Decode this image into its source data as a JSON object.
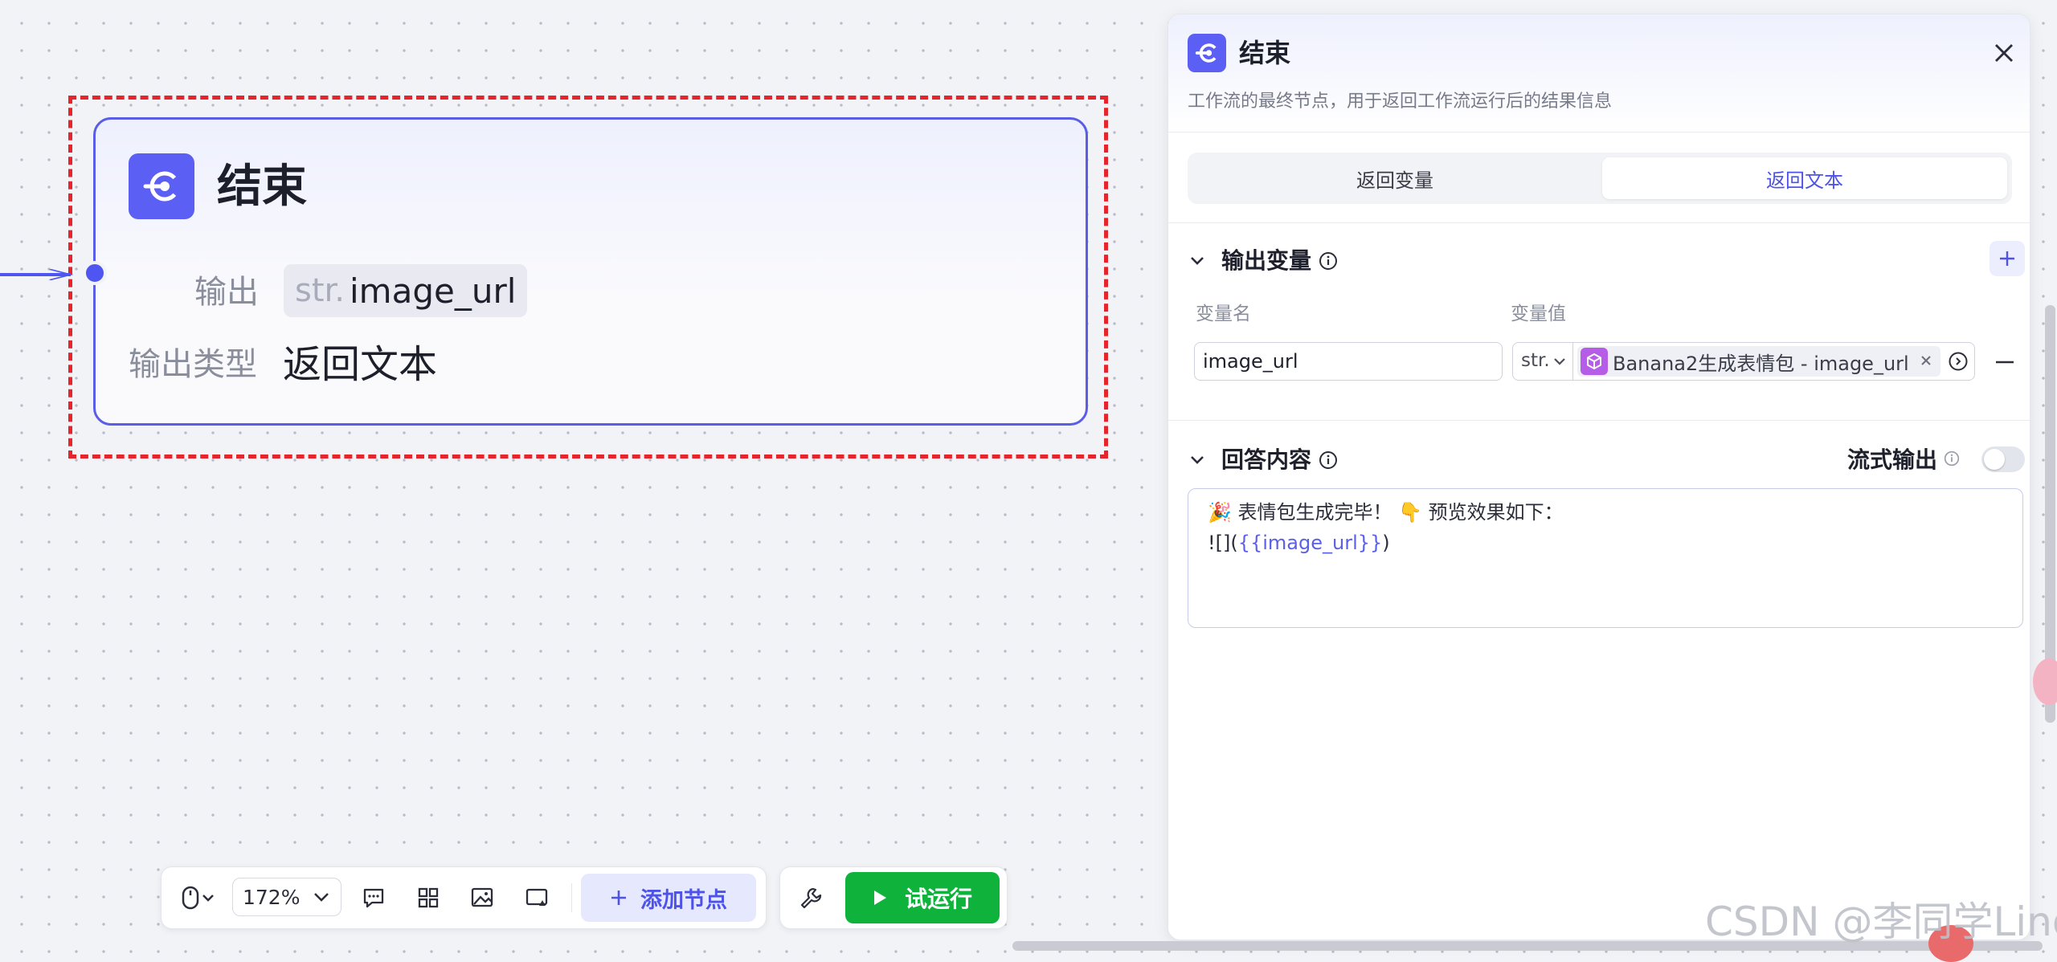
{
  "canvas": {
    "node": {
      "title": "结束",
      "output_label": "输出",
      "output_var_type": "str.",
      "output_var_name": "image_url",
      "output_type_label": "输出类型",
      "output_type_value": "返回文本"
    },
    "toolbar": {
      "zoom_value": "172%",
      "add_node_label": "添加节点",
      "run_label": "试运行"
    }
  },
  "panel": {
    "title": "结束",
    "description": "工作流的最终节点，用于返回工作流运行后的结果信息",
    "tabs": [
      {
        "label": "返回变量",
        "active": false
      },
      {
        "label": "返回文本",
        "active": true
      }
    ],
    "output_section": {
      "title": "输出变量",
      "col_name": "变量名",
      "col_value": "变量值",
      "row": {
        "name": "image_url",
        "type": "str.",
        "ref": "Banana2生成表情包 - image_url"
      }
    },
    "answer_section": {
      "title": "回答内容",
      "stream_label": "流式输出",
      "stream_enabled": false,
      "content_line1": "🎉 表情包生成完毕！ 👇 预览效果如下：",
      "content_line2_prefix": "![](",
      "content_line2_var": "{{image_url}}",
      "content_line2_suffix": ")"
    }
  },
  "watermark": "CSDN @李同学Lino",
  "colors": {
    "accent": "#5b5ff3",
    "selection": "#e6242b",
    "run_green": "#0fb33c"
  }
}
